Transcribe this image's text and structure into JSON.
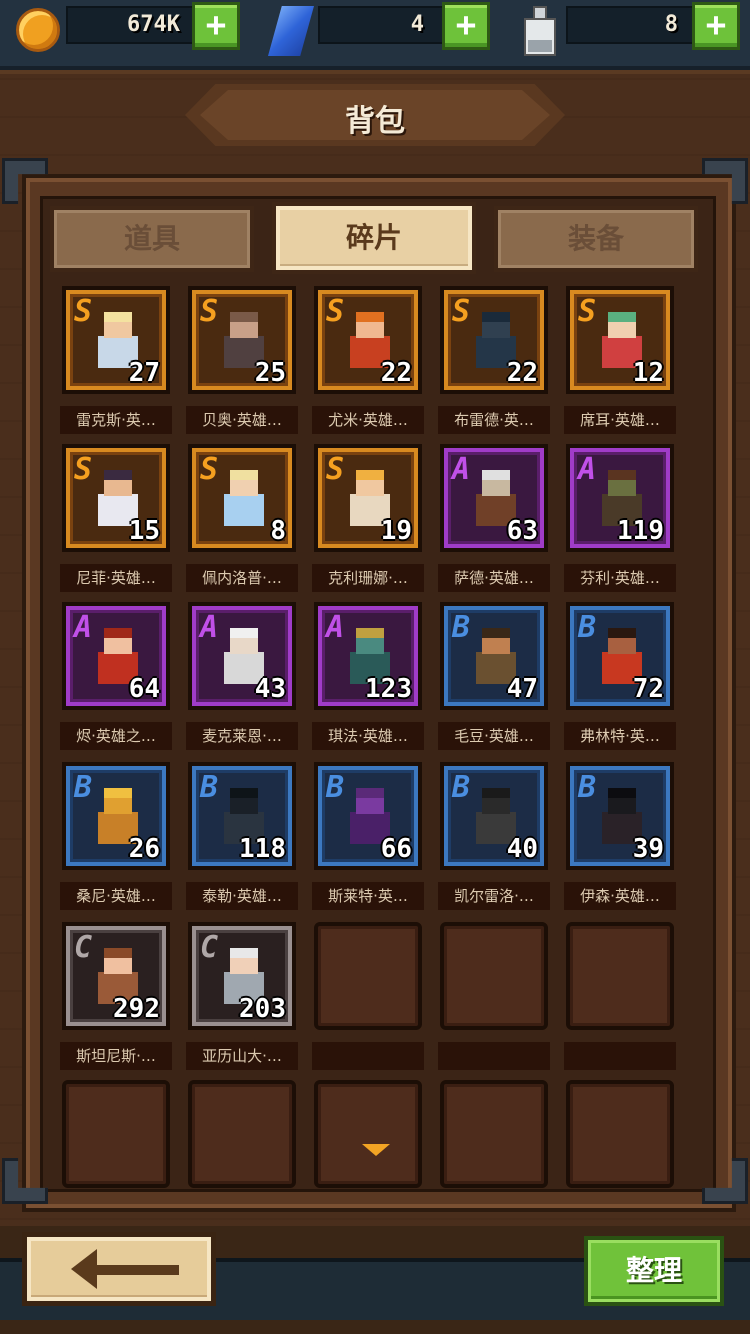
{
  "resources": {
    "gold": "674K",
    "gems": "4",
    "potion": "8"
  },
  "title": "背包",
  "tabs": [
    "道具",
    "碎片",
    "装备"
  ],
  "active_tab": 1,
  "shards": [
    {
      "grade": "S",
      "count": "27",
      "name": "雷克斯·英…",
      "skin": "#f0c8a0",
      "hair": "#f4e2a0",
      "cloth": "#c8d8e8"
    },
    {
      "grade": "S",
      "count": "25",
      "name": "贝奥·英雄…",
      "skin": "#c8a088",
      "hair": "#7a5a48",
      "cloth": "#504040"
    },
    {
      "grade": "S",
      "count": "22",
      "name": "尤米·英雄…",
      "skin": "#f0b890",
      "hair": "#e07020",
      "cloth": "#c84020"
    },
    {
      "grade": "S",
      "count": "22",
      "name": "布雷德·英…",
      "skin": "#304050",
      "hair": "#1a2a3a",
      "cloth": "#243648"
    },
    {
      "grade": "S",
      "count": "12",
      "name": "席耳·英雄…",
      "skin": "#f0d0b0",
      "hair": "#5ab080",
      "cloth": "#d04040"
    },
    {
      "grade": "S",
      "count": "15",
      "name": "尼菲·英雄…",
      "skin": "#e8b890",
      "hair": "#3a2a40",
      "cloth": "#e8e8f0"
    },
    {
      "grade": "S",
      "count": "8",
      "name": "佩内洛普·…",
      "skin": "#f0d0b0",
      "hair": "#f0e0a0",
      "cloth": "#a8d0f0"
    },
    {
      "grade": "S",
      "count": "19",
      "name": "克利珊娜·…",
      "skin": "#f0c8a0",
      "hair": "#f0b040",
      "cloth": "#e8d8c0"
    },
    {
      "grade": "A",
      "count": "63",
      "name": "萨德·英雄…",
      "skin": "#c8b8a0",
      "hair": "#e0e0e0",
      "cloth": "#704028"
    },
    {
      "grade": "A",
      "count": "119",
      "name": "芬利·英雄…",
      "skin": "#6a7040",
      "hair": "#5a3420",
      "cloth": "#4a3a28"
    },
    {
      "grade": "A",
      "count": "64",
      "name": "烬·英雄之…",
      "skin": "#f0c0a0",
      "hair": "#a02818",
      "cloth": "#c03020"
    },
    {
      "grade": "A",
      "count": "43",
      "name": "麦克莱恩·…",
      "skin": "#e8d8c8",
      "hair": "#f0f0f0",
      "cloth": "#d8d8d8"
    },
    {
      "grade": "A",
      "count": "123",
      "name": "琪法·英雄…",
      "skin": "#4a8a80",
      "hair": "#c0a040",
      "cloth": "#2a5a58"
    },
    {
      "grade": "B",
      "count": "47",
      "name": "毛豆·英雄…",
      "skin": "#c08050",
      "hair": "#3a2818",
      "cloth": "#6a5030"
    },
    {
      "grade": "B",
      "count": "72",
      "name": "弗林特·英…",
      "skin": "#a86040",
      "hair": "#2a1810",
      "cloth": "#c83820"
    },
    {
      "grade": "B",
      "count": "26",
      "name": "桑尼·英雄…",
      "skin": "#e0a030",
      "hair": "#f0c040",
      "cloth": "#c88028"
    },
    {
      "grade": "B",
      "count": "118",
      "name": "泰勒·英雄…",
      "skin": "#1a2028",
      "hair": "#0e1418",
      "cloth": "#2a3440"
    },
    {
      "grade": "B",
      "count": "66",
      "name": "斯莱特·英…",
      "skin": "#7a3aa0",
      "hair": "#5a2a78",
      "cloth": "#4a2068"
    },
    {
      "grade": "B",
      "count": "40",
      "name": "凯尔雷洛·…",
      "skin": "#2a2a2a",
      "hair": "#1a1a1a",
      "cloth": "#3a3a3a"
    },
    {
      "grade": "B",
      "count": "39",
      "name": "伊森·英雄…",
      "skin": "#1a1a1e",
      "hair": "#0c0c10",
      "cloth": "#2a2228"
    },
    {
      "grade": "C",
      "count": "292",
      "name": "斯坦尼斯·…",
      "skin": "#f0c0a0",
      "hair": "#8a4a28",
      "cloth": "#9a5a38"
    },
    {
      "grade": "C",
      "count": "203",
      "name": "亚历山大·…",
      "skin": "#f0d0b8",
      "hair": "#e8e8e8",
      "cloth": "#a0a8b0"
    }
  ],
  "sort_button": "整理"
}
